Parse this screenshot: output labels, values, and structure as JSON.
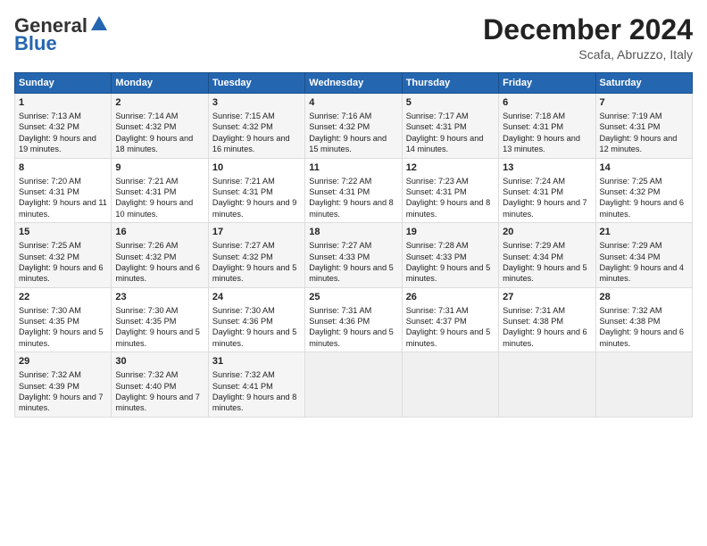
{
  "header": {
    "logo_line1": "General",
    "logo_line2": "Blue",
    "title": "December 2024",
    "subtitle": "Scafa, Abruzzo, Italy"
  },
  "columns": [
    "Sunday",
    "Monday",
    "Tuesday",
    "Wednesday",
    "Thursday",
    "Friday",
    "Saturday"
  ],
  "weeks": [
    [
      {
        "day": "1",
        "info": "Sunrise: 7:13 AM\nSunset: 4:32 PM\nDaylight: 9 hours and 19 minutes."
      },
      {
        "day": "2",
        "info": "Sunrise: 7:14 AM\nSunset: 4:32 PM\nDaylight: 9 hours and 18 minutes."
      },
      {
        "day": "3",
        "info": "Sunrise: 7:15 AM\nSunset: 4:32 PM\nDaylight: 9 hours and 16 minutes."
      },
      {
        "day": "4",
        "info": "Sunrise: 7:16 AM\nSunset: 4:32 PM\nDaylight: 9 hours and 15 minutes."
      },
      {
        "day": "5",
        "info": "Sunrise: 7:17 AM\nSunset: 4:31 PM\nDaylight: 9 hours and 14 minutes."
      },
      {
        "day": "6",
        "info": "Sunrise: 7:18 AM\nSunset: 4:31 PM\nDaylight: 9 hours and 13 minutes."
      },
      {
        "day": "7",
        "info": "Sunrise: 7:19 AM\nSunset: 4:31 PM\nDaylight: 9 hours and 12 minutes."
      }
    ],
    [
      {
        "day": "8",
        "info": "Sunrise: 7:20 AM\nSunset: 4:31 PM\nDaylight: 9 hours and 11 minutes."
      },
      {
        "day": "9",
        "info": "Sunrise: 7:21 AM\nSunset: 4:31 PM\nDaylight: 9 hours and 10 minutes."
      },
      {
        "day": "10",
        "info": "Sunrise: 7:21 AM\nSunset: 4:31 PM\nDaylight: 9 hours and 9 minutes."
      },
      {
        "day": "11",
        "info": "Sunrise: 7:22 AM\nSunset: 4:31 PM\nDaylight: 9 hours and 8 minutes."
      },
      {
        "day": "12",
        "info": "Sunrise: 7:23 AM\nSunset: 4:31 PM\nDaylight: 9 hours and 8 minutes."
      },
      {
        "day": "13",
        "info": "Sunrise: 7:24 AM\nSunset: 4:31 PM\nDaylight: 9 hours and 7 minutes."
      },
      {
        "day": "14",
        "info": "Sunrise: 7:25 AM\nSunset: 4:32 PM\nDaylight: 9 hours and 6 minutes."
      }
    ],
    [
      {
        "day": "15",
        "info": "Sunrise: 7:25 AM\nSunset: 4:32 PM\nDaylight: 9 hours and 6 minutes."
      },
      {
        "day": "16",
        "info": "Sunrise: 7:26 AM\nSunset: 4:32 PM\nDaylight: 9 hours and 6 minutes."
      },
      {
        "day": "17",
        "info": "Sunrise: 7:27 AM\nSunset: 4:32 PM\nDaylight: 9 hours and 5 minutes."
      },
      {
        "day": "18",
        "info": "Sunrise: 7:27 AM\nSunset: 4:33 PM\nDaylight: 9 hours and 5 minutes."
      },
      {
        "day": "19",
        "info": "Sunrise: 7:28 AM\nSunset: 4:33 PM\nDaylight: 9 hours and 5 minutes."
      },
      {
        "day": "20",
        "info": "Sunrise: 7:29 AM\nSunset: 4:34 PM\nDaylight: 9 hours and 5 minutes."
      },
      {
        "day": "21",
        "info": "Sunrise: 7:29 AM\nSunset: 4:34 PM\nDaylight: 9 hours and 4 minutes."
      }
    ],
    [
      {
        "day": "22",
        "info": "Sunrise: 7:30 AM\nSunset: 4:35 PM\nDaylight: 9 hours and 5 minutes."
      },
      {
        "day": "23",
        "info": "Sunrise: 7:30 AM\nSunset: 4:35 PM\nDaylight: 9 hours and 5 minutes."
      },
      {
        "day": "24",
        "info": "Sunrise: 7:30 AM\nSunset: 4:36 PM\nDaylight: 9 hours and 5 minutes."
      },
      {
        "day": "25",
        "info": "Sunrise: 7:31 AM\nSunset: 4:36 PM\nDaylight: 9 hours and 5 minutes."
      },
      {
        "day": "26",
        "info": "Sunrise: 7:31 AM\nSunset: 4:37 PM\nDaylight: 9 hours and 5 minutes."
      },
      {
        "day": "27",
        "info": "Sunrise: 7:31 AM\nSunset: 4:38 PM\nDaylight: 9 hours and 6 minutes."
      },
      {
        "day": "28",
        "info": "Sunrise: 7:32 AM\nSunset: 4:38 PM\nDaylight: 9 hours and 6 minutes."
      }
    ],
    [
      {
        "day": "29",
        "info": "Sunrise: 7:32 AM\nSunset: 4:39 PM\nDaylight: 9 hours and 7 minutes."
      },
      {
        "day": "30",
        "info": "Sunrise: 7:32 AM\nSunset: 4:40 PM\nDaylight: 9 hours and 7 minutes."
      },
      {
        "day": "31",
        "info": "Sunrise: 7:32 AM\nSunset: 4:41 PM\nDaylight: 9 hours and 8 minutes."
      },
      null,
      null,
      null,
      null
    ]
  ]
}
